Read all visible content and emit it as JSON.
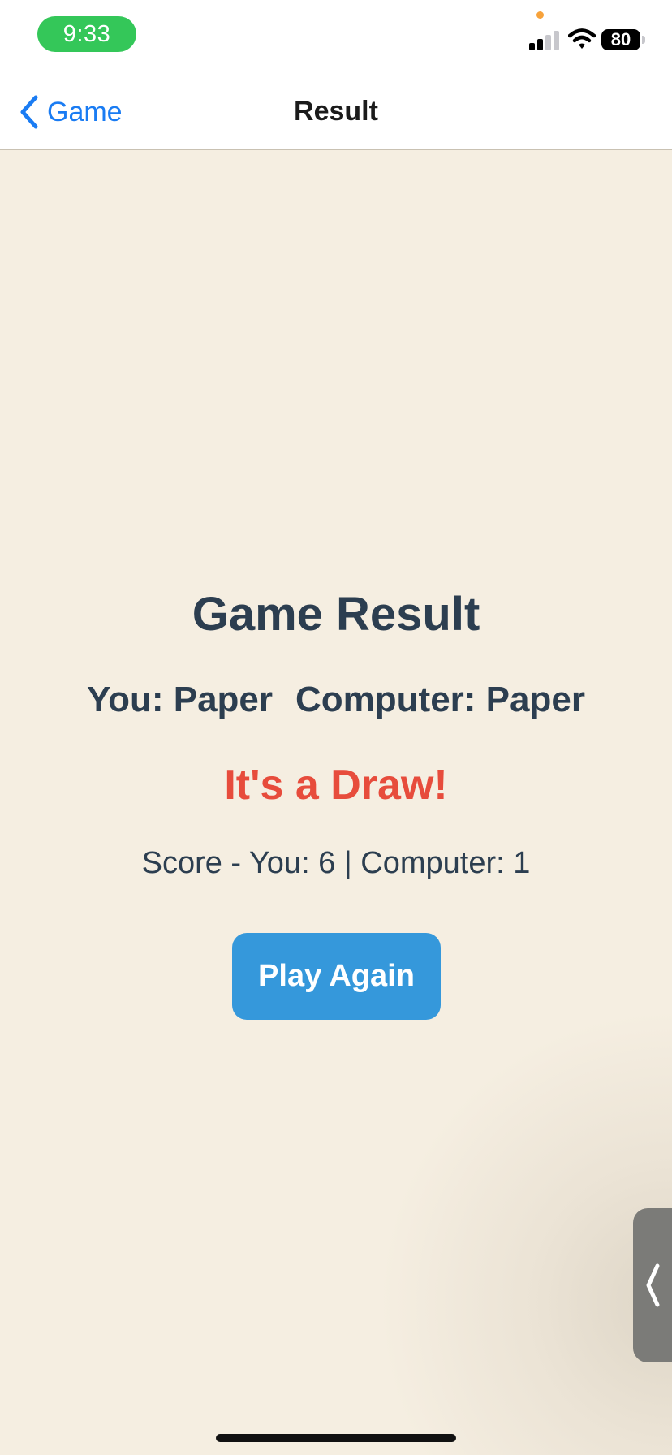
{
  "status_bar": {
    "time": "9:33",
    "battery": "80",
    "icons": [
      "cellular-signal-icon",
      "wifi-icon",
      "battery-icon"
    ]
  },
  "nav": {
    "back_label": "Game",
    "back_icon": "chevron-left-icon",
    "title": "Result"
  },
  "result": {
    "title": "Game Result",
    "player_choice": "You: Paper",
    "computer_choice": "Computer: Paper",
    "outcome": "It's a Draw!",
    "score": "Score - You: 6 | Computer: 1"
  },
  "actions": {
    "play_again_label": "Play Again"
  },
  "overlay": {
    "side_handle_icon": "chevron-left-icon"
  },
  "colors": {
    "background": "#f5eee1",
    "heading": "#2c3e50",
    "outcome": "#e74c3c",
    "button": "#3598db",
    "link": "#1a7cf3",
    "time_pill": "#34c759"
  }
}
